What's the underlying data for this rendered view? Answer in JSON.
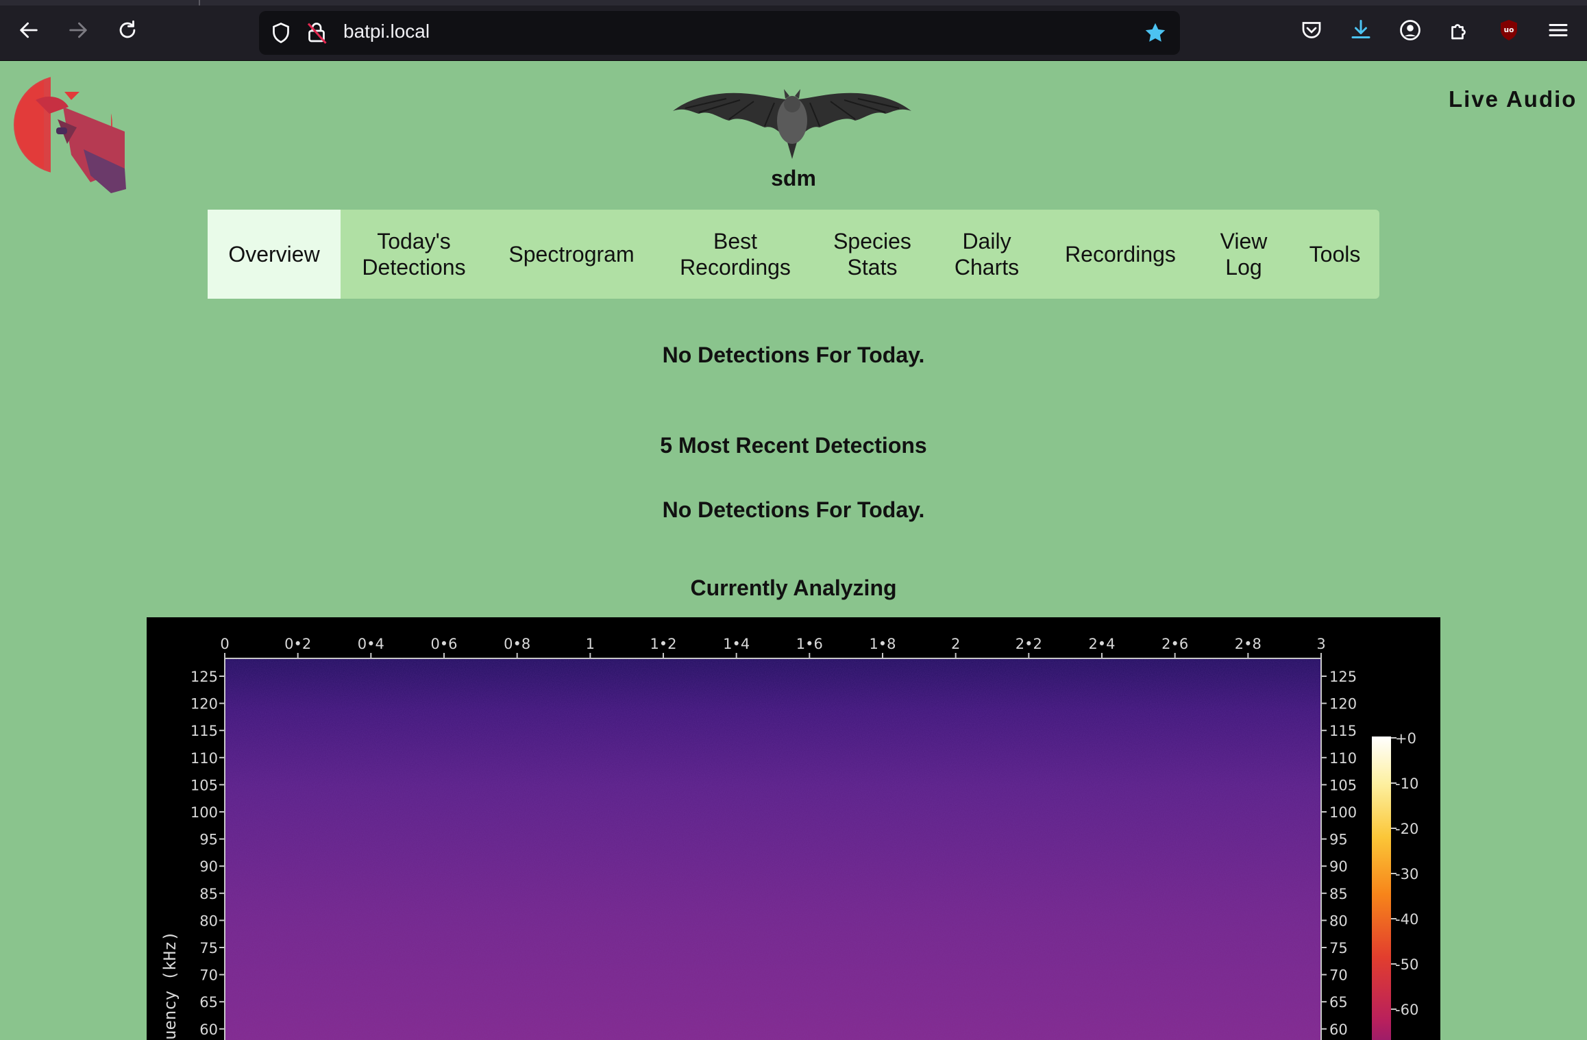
{
  "browser": {
    "url": "batpi.local",
    "icons": [
      "back-arrow-icon",
      "forward-arrow-icon",
      "reload-icon",
      "shield-icon",
      "insecure-lock-icon",
      "bookmark-star-icon",
      "pocket-icon",
      "download-icon",
      "account-icon",
      "extensions-icon",
      "ublock-icon",
      "hamburger-menu-icon"
    ],
    "accent": "#4cc3f2"
  },
  "header": {
    "live_audio": "Live Audio",
    "site_name": "sdm"
  },
  "menu": {
    "items": [
      {
        "label": "Overview",
        "active": true
      },
      {
        "label": "Today's\nDetections"
      },
      {
        "label": "Spectrogram"
      },
      {
        "label": "Best\nRecordings"
      },
      {
        "label": "Species\nStats"
      },
      {
        "label": "Daily\nCharts"
      },
      {
        "label": "Recordings"
      },
      {
        "label": "View\nLog"
      },
      {
        "label": "Tools"
      }
    ]
  },
  "main": {
    "no_detections_1": "No Detections For Today.",
    "recent_title": "5 Most Recent Detections",
    "no_detections_2": "No Detections For Today.",
    "analyzing_title": "Currently Analyzing"
  },
  "chart_data": {
    "type": "heatmap",
    "x_ticks": [
      "0",
      "0•2",
      "0•4",
      "0•6",
      "0•8",
      "1",
      "1•2",
      "1•4",
      "1•6",
      "1•8",
      "2",
      "2•2",
      "2•4",
      "2•6",
      "2•8",
      "3"
    ],
    "xlim": [
      0,
      3
    ],
    "y_ticks": [
      "125",
      "120",
      "115",
      "110",
      "105",
      "100",
      "95",
      "90",
      "85",
      "80",
      "75",
      "70",
      "65",
      "60"
    ],
    "ylabel": "uency (kHz)",
    "colorbar_ticks": [
      "+0",
      "-10",
      "-20",
      "-30",
      "-40",
      "-50",
      "-60"
    ],
    "colormap": [
      "#ffffff",
      "#fde76c",
      "#fb9b22",
      "#e6442e",
      "#b1205f",
      "#6e1d80",
      "#2a1376",
      "#000000"
    ],
    "background_color": "#8a2a8c"
  }
}
